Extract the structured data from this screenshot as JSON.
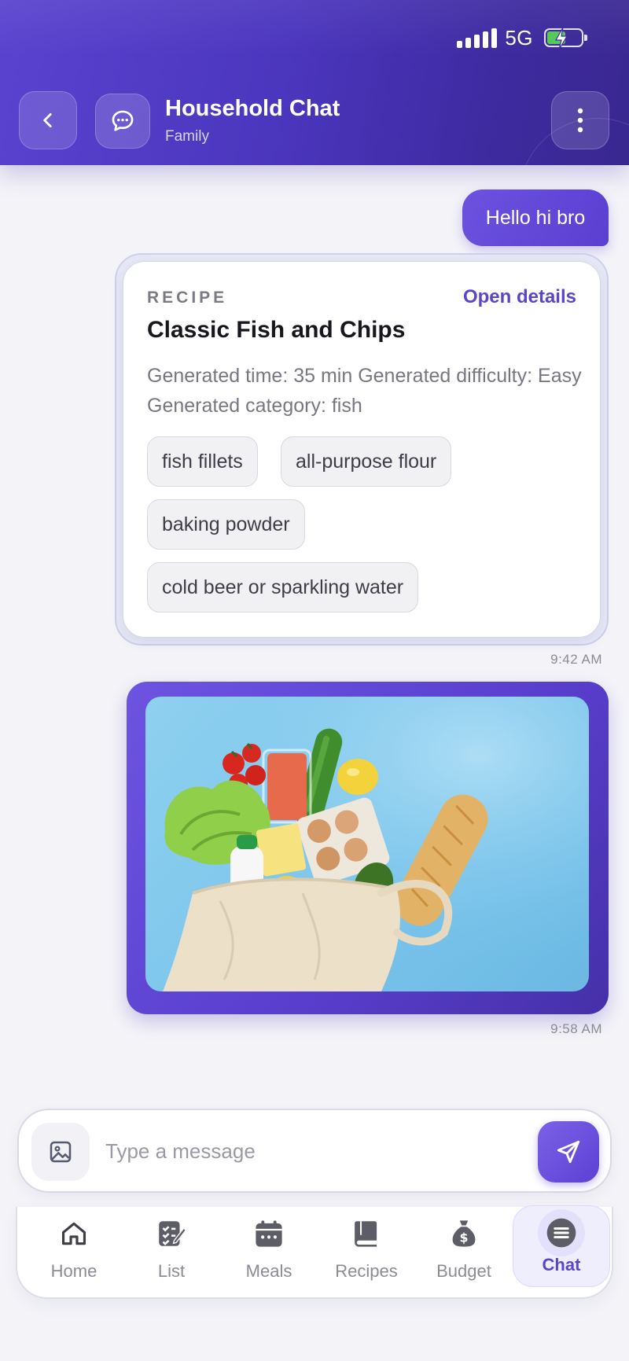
{
  "status_bar": {
    "network": "5G",
    "battery_level": 0.55,
    "battery_color": "#57c95a"
  },
  "header": {
    "title": "Household Chat",
    "subtitle": "Family",
    "icons": {
      "back": "chevron-left-icon",
      "chat": "chat-bubble-icon",
      "more": "more-vertical-icon"
    }
  },
  "messages": [
    {
      "type": "text",
      "text": "Hello hi bro"
    },
    {
      "type": "recipe",
      "label": "RECIPE",
      "action": "Open details",
      "title": "Classic Fish and Chips",
      "description": "Generated time: 35 min Generated difficulty: Easy Generated category: fish",
      "ingredients": [
        "fish fillets",
        "all-purpose flour",
        "baking powder",
        "cold beer or sparkling water"
      ],
      "time": "9:42 AM"
    },
    {
      "type": "image",
      "image": "photo of groceries in a tote bag on blue background",
      "time": "9:58 AM"
    }
  ],
  "composer": {
    "placeholder": "Type a message",
    "attach_icon": "image-icon",
    "send_icon": "send-icon"
  },
  "nav": {
    "items": [
      {
        "label": "Home",
        "icon": "home-icon"
      },
      {
        "label": "List",
        "icon": "checklist-icon"
      },
      {
        "label": "Meals",
        "icon": "calendar-icon"
      },
      {
        "label": "Recipes",
        "icon": "book-icon"
      },
      {
        "label": "Budget",
        "icon": "money-bag-icon"
      },
      {
        "label": "Chat",
        "icon": "chat-lines-icon",
        "active": true
      }
    ]
  },
  "colors": {
    "accent": "#5b45c9",
    "header_start": "#5a43cf",
    "header_end": "#3a2890",
    "background": "#f3f3f8"
  }
}
